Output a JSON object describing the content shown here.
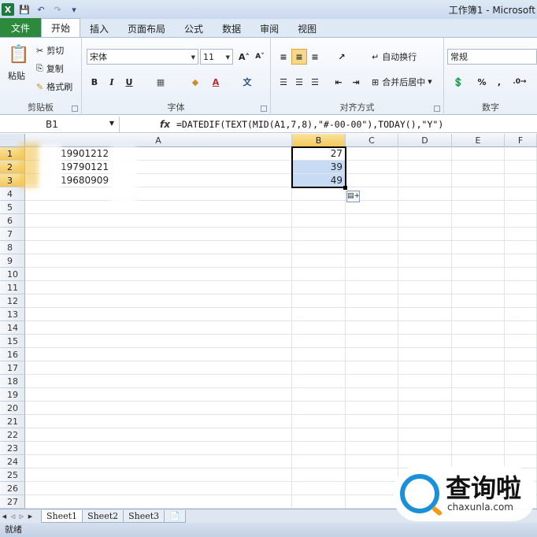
{
  "window": {
    "title": "工作簿1 - Microsoft"
  },
  "tabs": {
    "file": "文件",
    "items": [
      "开始",
      "插入",
      "页面布局",
      "公式",
      "数据",
      "审阅",
      "视图"
    ]
  },
  "ribbon": {
    "clipboard": {
      "paste": "粘贴",
      "cut": "剪切",
      "copy": "复制",
      "format_painter": "格式刷",
      "label": "剪贴板"
    },
    "font": {
      "name": "宋体",
      "size": "11",
      "bold": "B",
      "italic": "I",
      "underline": "U",
      "label": "字体"
    },
    "alignment": {
      "wrap": "自动换行",
      "merge": "合并后居中",
      "label": "对齐方式"
    },
    "number": {
      "format": "常规",
      "percent": "%",
      "comma": ",",
      "label": "数字"
    }
  },
  "formula_bar": {
    "name_box": "B1",
    "fx": "fx",
    "formula": "=DATEDIF(TEXT(MID(A1,7,8),\"#-00-00\"),TODAY(),\"Y\")"
  },
  "columns": [
    "A",
    "B",
    "C",
    "D",
    "E",
    "F"
  ],
  "rows": [
    "1",
    "2",
    "3",
    "4",
    "5",
    "6",
    "7",
    "8",
    "9",
    "10",
    "11",
    "12",
    "13",
    "14",
    "15",
    "16",
    "17",
    "18",
    "19",
    "20",
    "21",
    "22",
    "23",
    "24",
    "25",
    "26",
    "27"
  ],
  "cells": {
    "A": [
      "19901212",
      "19790121",
      "19680909"
    ],
    "B": [
      "27",
      "39",
      "49"
    ]
  },
  "sheets": [
    "Sheet1",
    "Sheet2",
    "Sheet3"
  ],
  "status": "就绪",
  "watermark": {
    "title": "查询啦",
    "sub": "chaxunla.com"
  }
}
